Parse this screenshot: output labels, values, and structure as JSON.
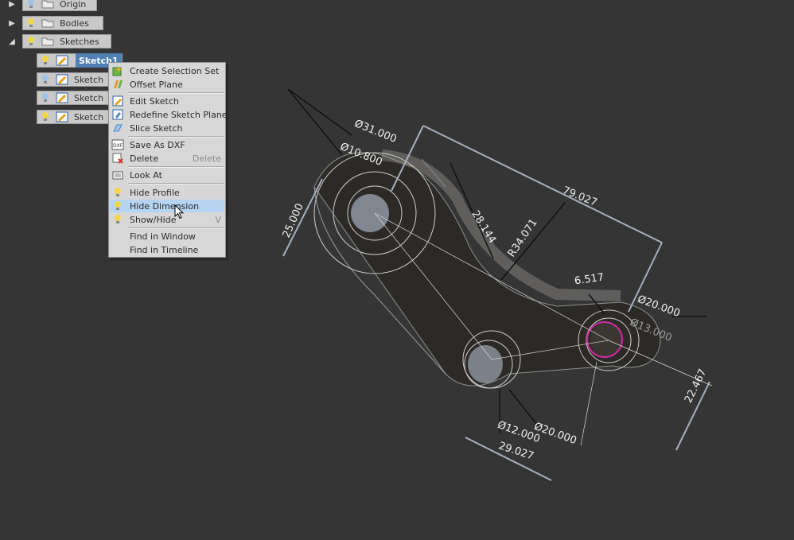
{
  "browser": {
    "origin": "Origin",
    "bodies": "Bodies",
    "sketches": "Sketches",
    "sketch_items": [
      "Sketch1",
      "Sketch",
      "Sketch",
      "Sketch"
    ]
  },
  "context_menu": {
    "items": [
      {
        "label": "Create Selection Set",
        "icon": "selection-set-icon"
      },
      {
        "label": "Offset Plane",
        "icon": "offset-plane-icon"
      },
      {
        "label": "Edit Sketch",
        "icon": "edit-sketch-icon"
      },
      {
        "label": "Redefine Sketch Plane",
        "icon": "redefine-plane-icon"
      },
      {
        "label": "Slice Sketch",
        "icon": "slice-sketch-icon"
      },
      {
        "label": "Save As DXF",
        "icon": "dxf-icon"
      },
      {
        "label": "Delete",
        "shortcut": "Delete",
        "icon": "delete-icon"
      },
      {
        "label": "Look At",
        "icon": "look-at-icon"
      },
      {
        "label": "Hide Profile",
        "icon": "lightbulb-icon"
      },
      {
        "label": "Hide Dimension",
        "icon": "lightbulb-icon"
      },
      {
        "label": "Show/Hide",
        "shortcut": "V",
        "icon": "lightbulb-icon"
      },
      {
        "label": "Find in Window",
        "icon": ""
      },
      {
        "label": "Find in Timeline",
        "icon": ""
      }
    ],
    "highlighted": "Hide Dimension"
  },
  "dimensions": {
    "d31": "Ø31.000",
    "d10": "Ø10.800",
    "d25": "25.000",
    "d79": "79.027",
    "d28": "28.144",
    "r34": "R34.071",
    "d6": "6.517",
    "d20a": "Ø20.000",
    "d13": "Ø13.000",
    "d22": "22.467",
    "d12": "Ø12.000",
    "d20b": "Ø20.000",
    "d29": "29.027"
  },
  "colors": {
    "background": "#353535",
    "node_bg": "#c9c9c9",
    "selected_bg": "#4f7fb3",
    "menu_bg": "#d7d7d7",
    "menu_highlight": "#b6d3f2",
    "accent_magenta": "#d02aa0"
  }
}
